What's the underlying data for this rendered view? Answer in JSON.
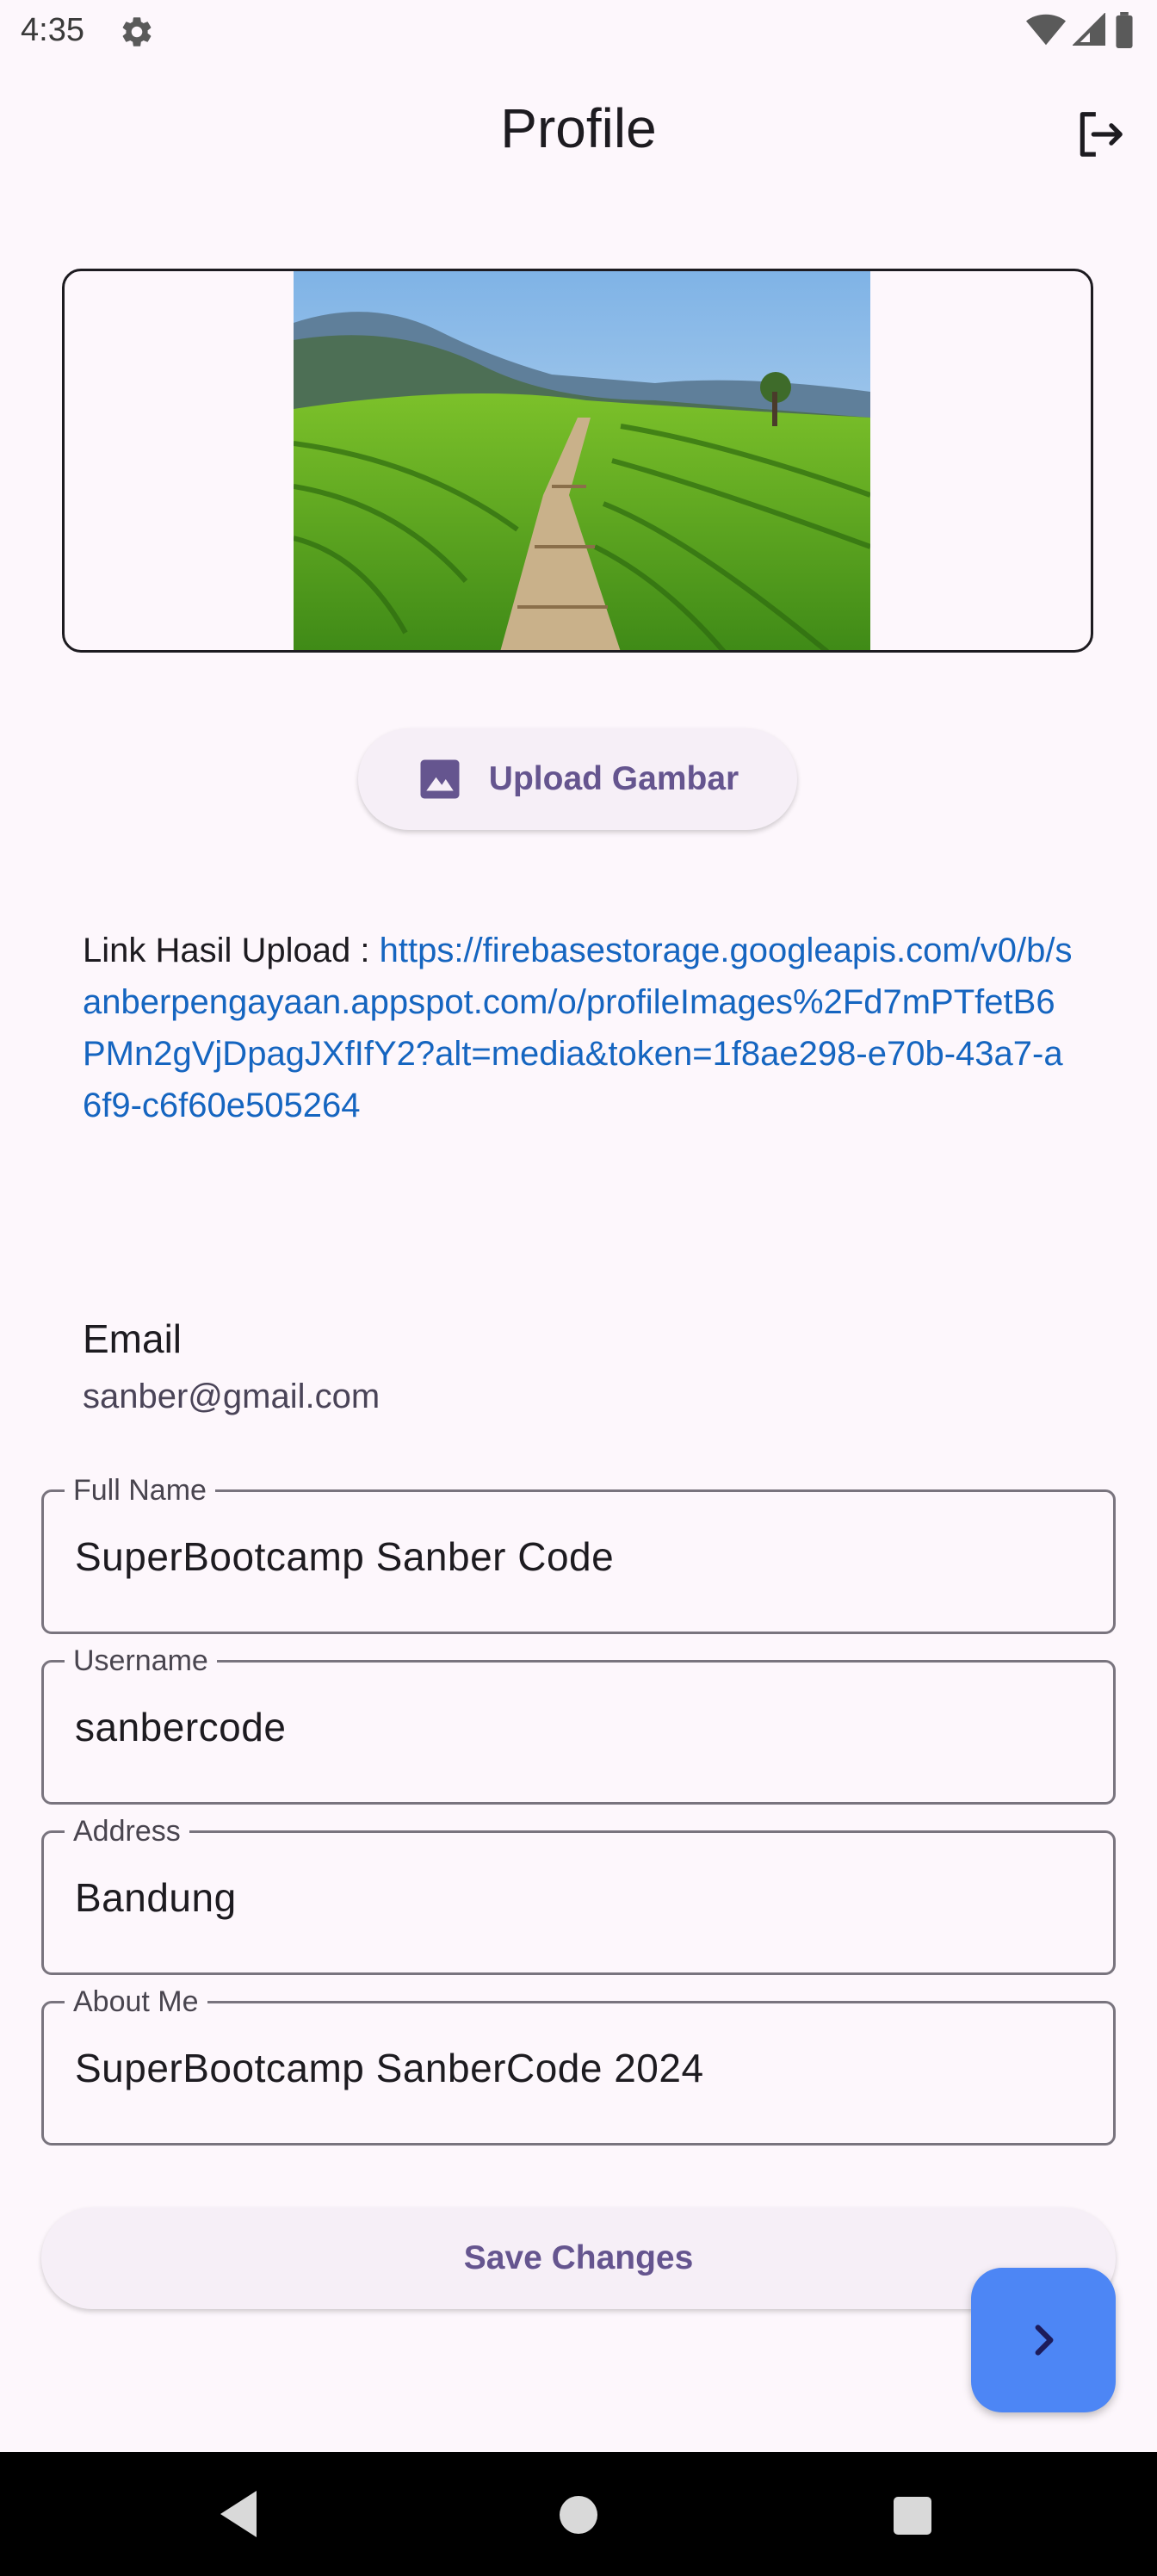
{
  "status_bar": {
    "time": "4:35",
    "icons": [
      "settings-gear-icon",
      "wifi-icon",
      "signal-icon",
      "battery-icon"
    ]
  },
  "app_bar": {
    "title": "Profile",
    "logout_icon": "logout-icon"
  },
  "profile_image": {
    "description_icon": "image-icon"
  },
  "upload_button": {
    "label": "Upload Gambar",
    "icon": "image-icon"
  },
  "upload_link": {
    "prefix": "Link Hasil Upload : ",
    "url": "https://firebasestorage.googleapis.com/v0/b/sanberpengayaan.appspot.com/o/profileImages%2Fd7mPTfetB6PMn2gVjDpagJXfIfY2?alt=media&token=1f8ae298-e70b-43a7-a6f9-c6f60e505264"
  },
  "email": {
    "label": "Email",
    "value": "sanber@gmail.com"
  },
  "fields": [
    {
      "label": "Full Name",
      "value": "SuperBootcamp Sanber Code"
    },
    {
      "label": "Username",
      "value": "sanbercode"
    },
    {
      "label": "Address",
      "value": "Bandung"
    },
    {
      "label": "About Me",
      "value": "SuperBootcamp SanberCode 2024"
    }
  ],
  "save_button": {
    "label": "Save Changes"
  },
  "fab": {
    "icon": "chevron-right-icon"
  },
  "colors": {
    "background": "#fdf7fc",
    "primary": "#65558f",
    "link": "#1565c0",
    "fab": "#4d86f5"
  }
}
